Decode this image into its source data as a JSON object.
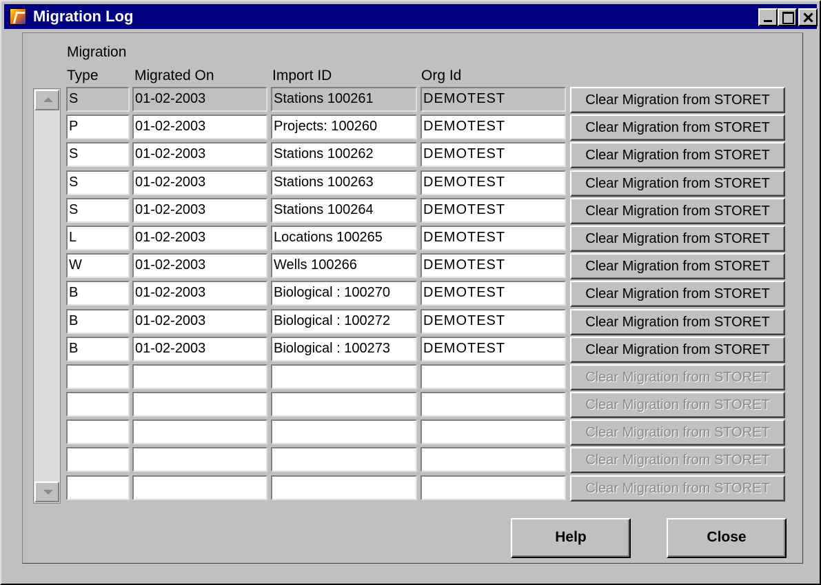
{
  "window": {
    "title": "Migration Log"
  },
  "columns": {
    "type_line1": "Migration",
    "type_line2": "Type",
    "migrated_on": "Migrated On",
    "import_id": "Import ID",
    "org_id": "Org Id"
  },
  "rows": [
    {
      "type": "S",
      "migrated_on": "01-02-2003",
      "import_id": "Stations 100261",
      "org_id": "DEMOTEST",
      "action": "Clear Migration from STORET"
    },
    {
      "type": "P",
      "migrated_on": "01-02-2003",
      "import_id": "Projects: 100260",
      "org_id": "DEMOTEST",
      "action": "Clear Migration from STORET"
    },
    {
      "type": "S",
      "migrated_on": "01-02-2003",
      "import_id": "Stations 100262",
      "org_id": "DEMOTEST",
      "action": "Clear Migration from STORET"
    },
    {
      "type": "S",
      "migrated_on": "01-02-2003",
      "import_id": "Stations 100263",
      "org_id": "DEMOTEST",
      "action": "Clear Migration from STORET"
    },
    {
      "type": "S",
      "migrated_on": "01-02-2003",
      "import_id": "Stations 100264",
      "org_id": "DEMOTEST",
      "action": "Clear Migration from STORET"
    },
    {
      "type": "L",
      "migrated_on": "01-02-2003",
      "import_id": "Locations 100265",
      "org_id": "DEMOTEST",
      "action": "Clear Migration from STORET"
    },
    {
      "type": "W",
      "migrated_on": "01-02-2003",
      "import_id": "Wells 100266",
      "org_id": "DEMOTEST",
      "action": "Clear Migration from STORET"
    },
    {
      "type": "B",
      "migrated_on": "01-02-2003",
      "import_id": "Biological : 100270",
      "org_id": "DEMOTEST",
      "action": "Clear Migration from STORET"
    },
    {
      "type": "B",
      "migrated_on": "01-02-2003",
      "import_id": "Biological : 100272",
      "org_id": "DEMOTEST",
      "action": "Clear Migration from STORET"
    },
    {
      "type": "B",
      "migrated_on": "01-02-2003",
      "import_id": "Biological : 100273",
      "org_id": "DEMOTEST",
      "action": "Clear Migration from STORET"
    },
    {
      "type": "",
      "migrated_on": "",
      "import_id": "",
      "org_id": "",
      "action": "Clear Migration from STORET"
    },
    {
      "type": "",
      "migrated_on": "",
      "import_id": "",
      "org_id": "",
      "action": "Clear Migration from STORET"
    },
    {
      "type": "",
      "migrated_on": "",
      "import_id": "",
      "org_id": "",
      "action": "Clear Migration from STORET"
    },
    {
      "type": "",
      "migrated_on": "",
      "import_id": "",
      "org_id": "",
      "action": "Clear Migration from STORET"
    },
    {
      "type": "",
      "migrated_on": "",
      "import_id": "",
      "org_id": "",
      "action": "Clear Migration from STORET"
    }
  ],
  "buttons": {
    "help": "Help",
    "close": "Close"
  },
  "icons": {
    "app": "migration-app-icon",
    "minimize": "minimize-icon",
    "maximize": "maximize-icon",
    "close": "close-icon",
    "scroll_up": "scroll-up-arrow-icon",
    "scroll_down": "scroll-down-arrow-icon"
  },
  "colors": {
    "titlebar": "#000080",
    "window_bg": "#c0c0c0",
    "disabled_text": "#8a8a8a"
  }
}
